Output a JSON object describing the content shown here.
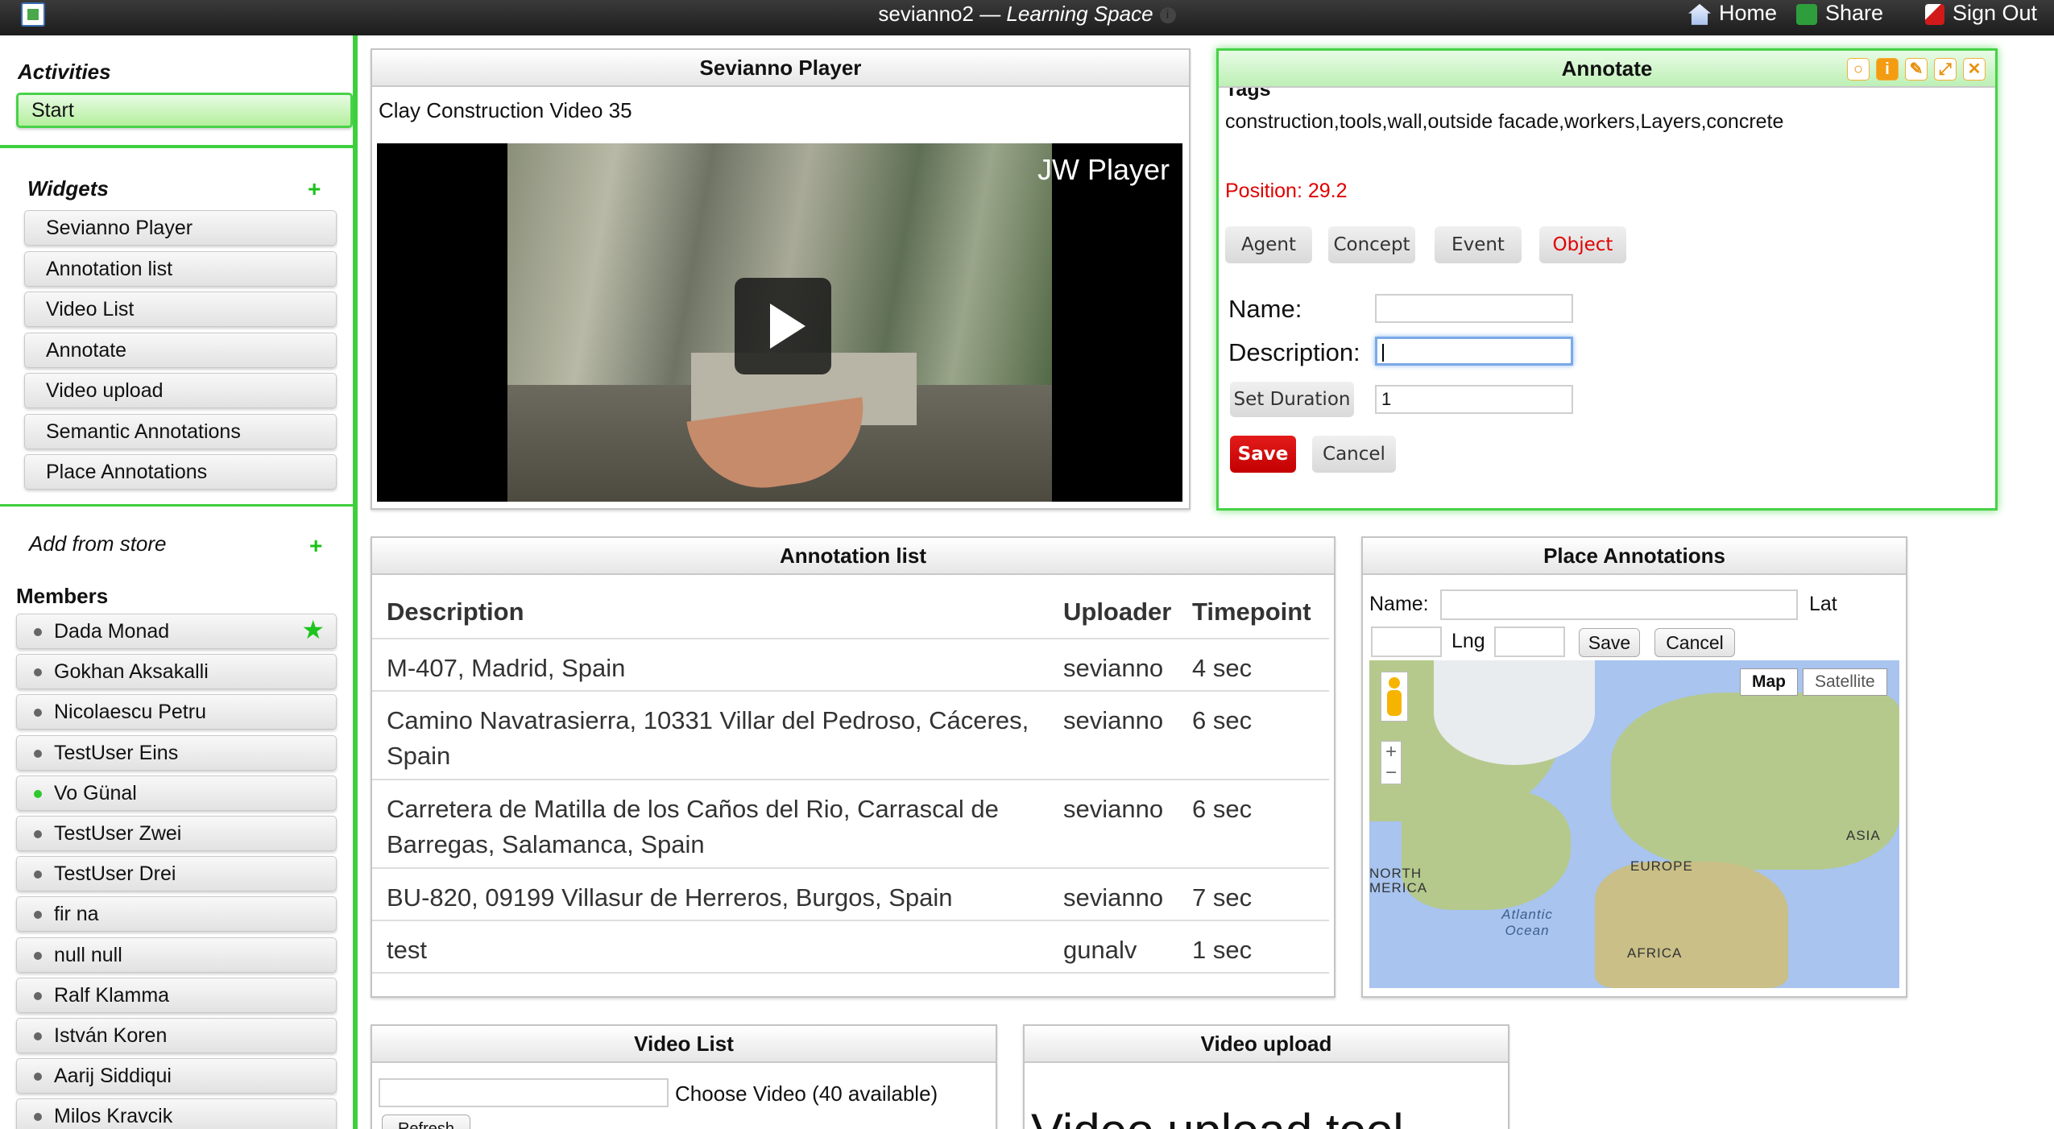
{
  "topbar": {
    "space_name": "sevianno2",
    "separator": " — ",
    "app_name": "Learning Space",
    "info_icon": "i",
    "home_label": "Home",
    "share_label": "Share",
    "signout_label": "Sign Out"
  },
  "sidebar": {
    "activities_heading": "Activities",
    "start_label": "Start",
    "widgets_heading": "Widgets",
    "add_icon": "+",
    "widgets": [
      "Sevianno Player",
      "Annotation list",
      "Video List",
      "Annotate",
      "Video upload",
      "Semantic Annotations",
      "Place Annotations"
    ],
    "add_from_store": "Add from store",
    "members_heading": "Members",
    "members": [
      {
        "name": "Dada Monad",
        "online": false,
        "owner": true
      },
      {
        "name": "Gokhan Aksakalli",
        "online": false
      },
      {
        "name": "Nicolaescu Petru",
        "online": false
      },
      {
        "name": "TestUser Eins",
        "online": false
      },
      {
        "name": "Vo Günal",
        "online": true
      },
      {
        "name": "TestUser Zwei",
        "online": false
      },
      {
        "name": "TestUser Drei",
        "online": false
      },
      {
        "name": "fir na",
        "online": false
      },
      {
        "name": "null null",
        "online": false
      },
      {
        "name": "Ralf Klamma",
        "online": false
      },
      {
        "name": "István Koren",
        "online": false
      },
      {
        "name": "Aarij Siddiqui",
        "online": false
      },
      {
        "name": "Milos Kravcik",
        "online": false
      }
    ],
    "owner_star": "★"
  },
  "player": {
    "title": "Sevianno Player",
    "video_title": "Clay Construction Video 35",
    "watermark": "JW Player"
  },
  "annotate": {
    "title": "Annotate",
    "tags_label": "Tags",
    "tags": "construction,tools,wall,outside facade,workers,Layers,concrete",
    "position": "Position: 29.2",
    "types": [
      "Agent",
      "Concept",
      "Event",
      "Object"
    ],
    "selected_type": "Object",
    "name_label": "Name:",
    "name_value": "",
    "description_label": "Description:",
    "description_value": "",
    "set_duration_label": "Set Duration",
    "duration_value": "1",
    "save_label": "Save",
    "cancel_label": "Cancel",
    "header_icons": [
      "lightbulb-icon",
      "info-icon",
      "edit-icon",
      "maximize-icon",
      "close-icon"
    ]
  },
  "annotation_list": {
    "title": "Annotation list",
    "columns": [
      "Description",
      "Uploader",
      "Timepoint"
    ],
    "rows": [
      [
        "M-407, Madrid, Spain",
        "sevianno",
        "4 sec"
      ],
      [
        "Camino Navatrasierra, 10331 Villar del Pedroso, Cáceres, Spain",
        "sevianno",
        "6 sec"
      ],
      [
        "Carretera de Matilla de los Caños del Rio, Carrascal de Barregas, Salamanca, Spain",
        "sevianno",
        "6 sec"
      ],
      [
        "BU-820, 09199 Villasur de Herreros, Burgos, Spain",
        "sevianno",
        "7 sec"
      ],
      [
        "test",
        "gunalv",
        "1 sec"
      ]
    ]
  },
  "place_annotations": {
    "title": "Place Annotations",
    "name_label": "Name:",
    "lat_label": "Lat",
    "lng_label": "Lng",
    "save_label": "Save",
    "cancel_label": "Cancel",
    "map_label": "Map",
    "satellite_label": "Satellite",
    "zoom_in": "+",
    "zoom_out": "−",
    "map_labels": [
      "ASIA",
      "NORTH MERICA",
      "EUROPE",
      "Atlantic Ocean",
      "AFRICA"
    ]
  },
  "video_list": {
    "title": "Video List",
    "choose_label": "Choose Video (40 available)",
    "refresh_label": "Refresh"
  },
  "video_upload": {
    "title": "Video upload",
    "tool_text": "Video upload tool"
  }
}
